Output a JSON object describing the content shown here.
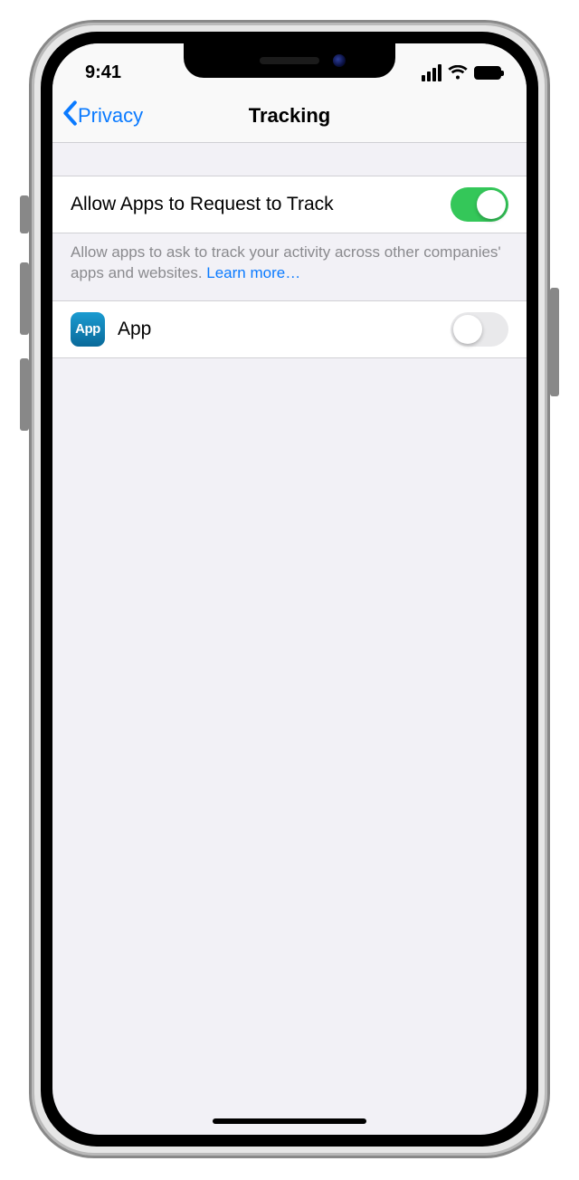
{
  "statusbar": {
    "time": "9:41"
  },
  "nav": {
    "back_label": "Privacy",
    "title": "Tracking"
  },
  "settings": {
    "allow": {
      "label": "Allow Apps to Request to Track",
      "value": true
    },
    "footer": {
      "text": "Allow apps to ask to track your activity across other companies' apps and websites. ",
      "link": "Learn more…"
    },
    "apps": [
      {
        "icon_label": "App",
        "name": "App",
        "value": false
      }
    ]
  }
}
